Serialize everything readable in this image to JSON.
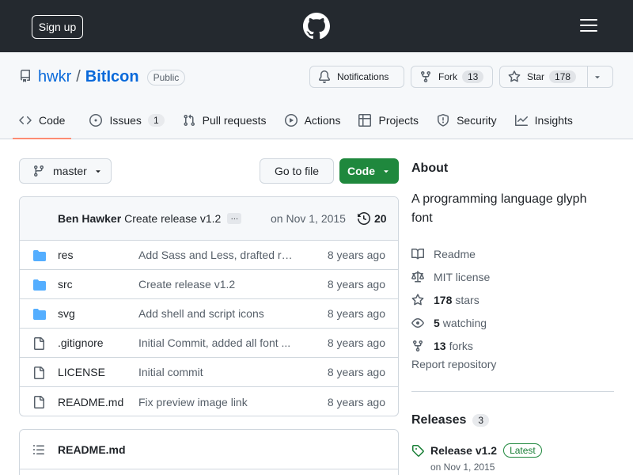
{
  "header": {
    "signup_label": "Sign up",
    "logo_icon": "github-logo-icon",
    "menu_icon": "hamburger-menu-icon"
  },
  "repo": {
    "owner": "hwkr",
    "separator": "/",
    "name": "BitIcon",
    "visibility": "Public",
    "notifications_label": "Notifications",
    "fork_label": "Fork",
    "fork_count": "13",
    "star_label": "Star",
    "star_count": "178"
  },
  "tabs": [
    {
      "label": "Code",
      "icon": "code-icon",
      "active": true
    },
    {
      "label": "Issues",
      "icon": "issue-icon",
      "count": "1"
    },
    {
      "label": "Pull requests",
      "icon": "pull-request-icon"
    },
    {
      "label": "Actions",
      "icon": "play-icon"
    },
    {
      "label": "Projects",
      "icon": "table-icon"
    },
    {
      "label": "Security",
      "icon": "shield-icon"
    },
    {
      "label": "Insights",
      "icon": "graph-icon"
    }
  ],
  "toolbar": {
    "branch": "master",
    "goto_file_label": "Go to file",
    "code_label": "Code"
  },
  "commit": {
    "author": "Ben Hawker",
    "message": "Create release v1.2",
    "ellipsis": "…",
    "date": "on Nov 1, 2015",
    "count": "20"
  },
  "files": [
    {
      "type": "dir",
      "name": "res",
      "message": "Add Sass and Less, drafted rel...",
      "age": "8 years ago"
    },
    {
      "type": "dir",
      "name": "src",
      "message": "Create release v1.2",
      "age": "8 years ago"
    },
    {
      "type": "dir",
      "name": "svg",
      "message": "Add shell and script icons",
      "age": "8 years ago"
    },
    {
      "type": "file",
      "name": ".gitignore",
      "message": "Initial Commit, added all font ...",
      "age": "8 years ago"
    },
    {
      "type": "file",
      "name": "LICENSE",
      "message": "Initial commit",
      "age": "8 years ago"
    },
    {
      "type": "file",
      "name": "README.md",
      "message": "Fix preview image link",
      "age": "8 years ago"
    }
  ],
  "readme": {
    "title": "README.md"
  },
  "about": {
    "title": "About",
    "description": "A programming language glyph font",
    "readme_label": "Readme",
    "license_label": "MIT license",
    "stars_count": "178",
    "stars_label": "stars",
    "watching_count": "5",
    "watching_label": "watching",
    "forks_count": "13",
    "forks_label": "forks",
    "report_label": "Report repository"
  },
  "releases": {
    "title": "Releases",
    "count": "3",
    "latest_name": "Release v1.2",
    "latest_badge": "Latest",
    "latest_date": "on Nov 1, 2015"
  },
  "colors": {
    "topbar": "#24292f",
    "link": "#0969da",
    "green": "#1f883d",
    "active_tab_underline": "#fd8c73",
    "folder": "#54aeff"
  }
}
